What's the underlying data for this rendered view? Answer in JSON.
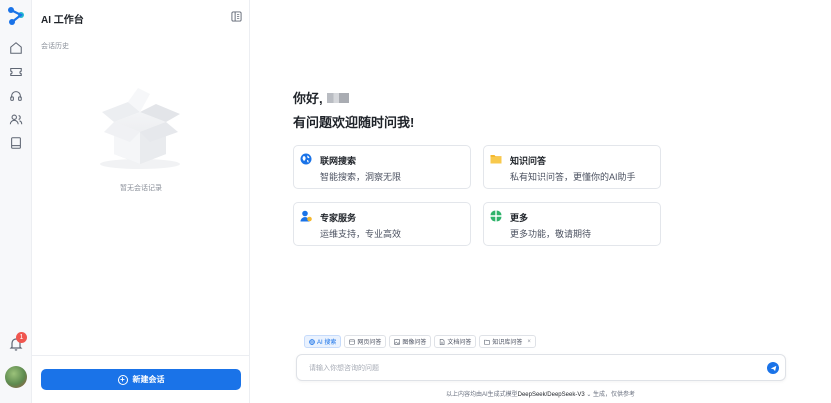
{
  "sidebar": {
    "nav_icons": [
      "home-icon",
      "ticket-icon",
      "headset-icon",
      "users-icon",
      "book-icon"
    ],
    "notification_count": "1"
  },
  "panel": {
    "title": "AI 工作台",
    "history_label": "会话历史",
    "empty_text": "暂无会话记录",
    "new_session_label": "新建会话"
  },
  "main": {
    "greeting": "你好,",
    "subtitle": "有问题欢迎随时问我!",
    "cards": [
      {
        "icon": "globe-icon",
        "title": "联网搜索",
        "desc": "智能搜索，洞察无限"
      },
      {
        "icon": "folder-icon",
        "title": "知识问答",
        "desc": "私有知识问答，更懂你的AI助手"
      },
      {
        "icon": "expert-icon",
        "title": "专家服务",
        "desc": "运维支持，专业高效"
      },
      {
        "icon": "grid-icon",
        "title": "更多",
        "desc": "更多功能，敬请期待"
      }
    ]
  },
  "composer": {
    "chips": [
      {
        "icon": "globe-icon",
        "label": "AI 搜索"
      },
      {
        "icon": "web-icon",
        "label": "网页问答"
      },
      {
        "icon": "image-icon",
        "label": "图像问答"
      },
      {
        "icon": "doc-icon",
        "label": "文档问答"
      },
      {
        "icon": "kb-icon",
        "label": "知识库问答"
      }
    ],
    "placeholder": "请输入你想咨询的问题",
    "disclaimer_prefix": "以上内容均由AI生成式模型",
    "model": "DeepSeek/DeepSeek-V3",
    "disclaimer_suffix": "生成，仅供参考"
  },
  "colors": {
    "primary": "#1a73e8",
    "badge": "#f0564f",
    "folder": "#f5b82e",
    "green": "#2fb36b"
  }
}
